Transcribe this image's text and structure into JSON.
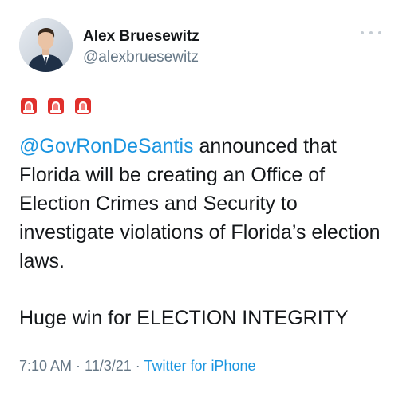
{
  "author": {
    "display_name": "Alex Bruesewitz",
    "handle": "@alexbruesewitz"
  },
  "tweet": {
    "emoji": [
      "police-light-emoji",
      "police-light-emoji",
      "police-light-emoji"
    ],
    "mention": "@GovRonDeSantis",
    "text_line1_rest": " announced that",
    "text_rest": "Florida will be creating an Office of Election Crimes and Security to investigate violations of Florida’s election laws.",
    "line2": "Huge win for ELECTION INTEGRITY"
  },
  "meta": {
    "time": "7:10 AM",
    "sep1": " · ",
    "date": "11/3/21",
    "sep2": " · ",
    "source": "Twitter for iPhone"
  },
  "colors": {
    "link": "#1b95e0",
    "secondary_text": "#657786",
    "siren_red": "#e0302c"
  }
}
